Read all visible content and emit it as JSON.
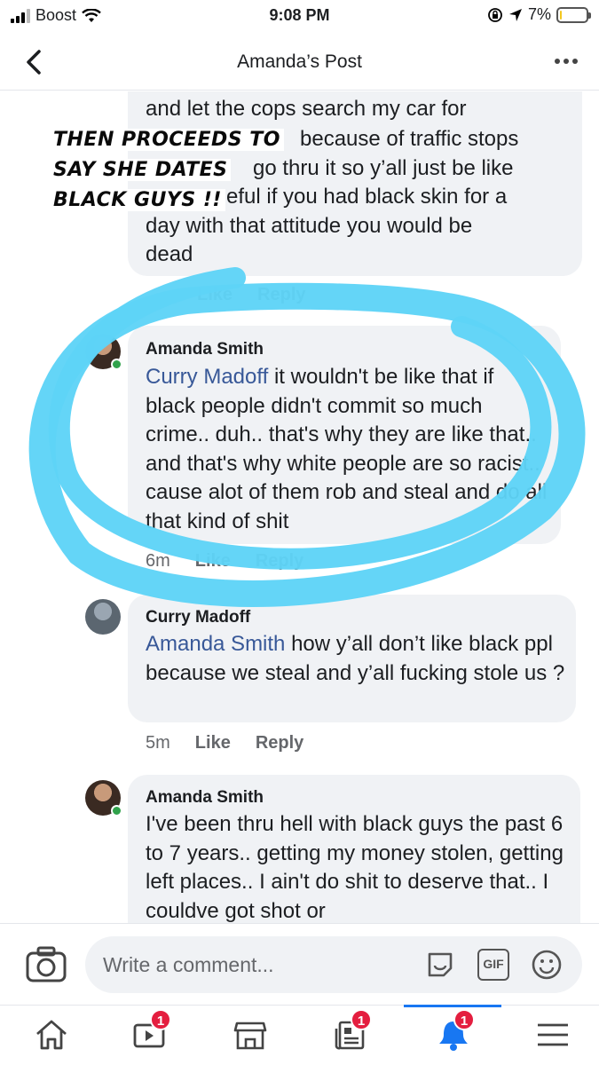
{
  "status_bar": {
    "carrier": "Boost",
    "time": "9:08 PM",
    "battery_text": "7%",
    "battery_level": 0.07
  },
  "header": {
    "title": "Amanda’s Post"
  },
  "overlay_caption": {
    "line1": "THEN PROCEEDS TO",
    "line2": "SAY SHE DATES",
    "line3": "BLACK GUYS !!"
  },
  "comments": [
    {
      "text_lines": [
        "and let the cops search my car for",
        "because of traffic stops",
        "go thru it so y’all just be like",
        "eful if you had black skin for a",
        "day with that attitude you would be",
        "dead"
      ],
      "actions": {
        "like": "Like",
        "reply": "Reply"
      }
    },
    {
      "author": "Amanda Smith",
      "mention": "Curry Madoff",
      "text": " it wouldn't be like that if black people didn't commit so much crime.. duh.. that's why they are like that.. and that's why white people are so racist.. cause alot of them rob and steal and do all that kind of shit",
      "time": "6m",
      "actions": {
        "like": "Like",
        "reply": "Reply"
      }
    },
    {
      "author": "Curry Madoff",
      "mention": "Amanda Smith",
      "text": " how y’all don’t like black ppl because we steal and y’all fucking stole us ?",
      "time": "5m",
      "actions": {
        "like": "Like",
        "reply": "Reply"
      }
    },
    {
      "author": "Amanda Smith",
      "text": "I've been thru hell with black guys the past 6 to 7 years.. getting my money stolen, getting left places.. I ain't do shit to deserve that.. I couldve got shot or"
    }
  ],
  "composer": {
    "placeholder": "Write a comment...",
    "gif_label": "GIF"
  },
  "tabbar": {
    "tabs": [
      {
        "name": "home",
        "badge": ""
      },
      {
        "name": "watch",
        "badge": "1"
      },
      {
        "name": "marketplace",
        "badge": ""
      },
      {
        "name": "news",
        "badge": "1"
      },
      {
        "name": "notifications",
        "badge": "1"
      },
      {
        "name": "menu",
        "badge": ""
      }
    ]
  },
  "colors": {
    "mention": "#385898",
    "highlight_circle": "#5ed3f7",
    "bubble": "#f0f2f5",
    "active_tab": "#1877f2"
  }
}
